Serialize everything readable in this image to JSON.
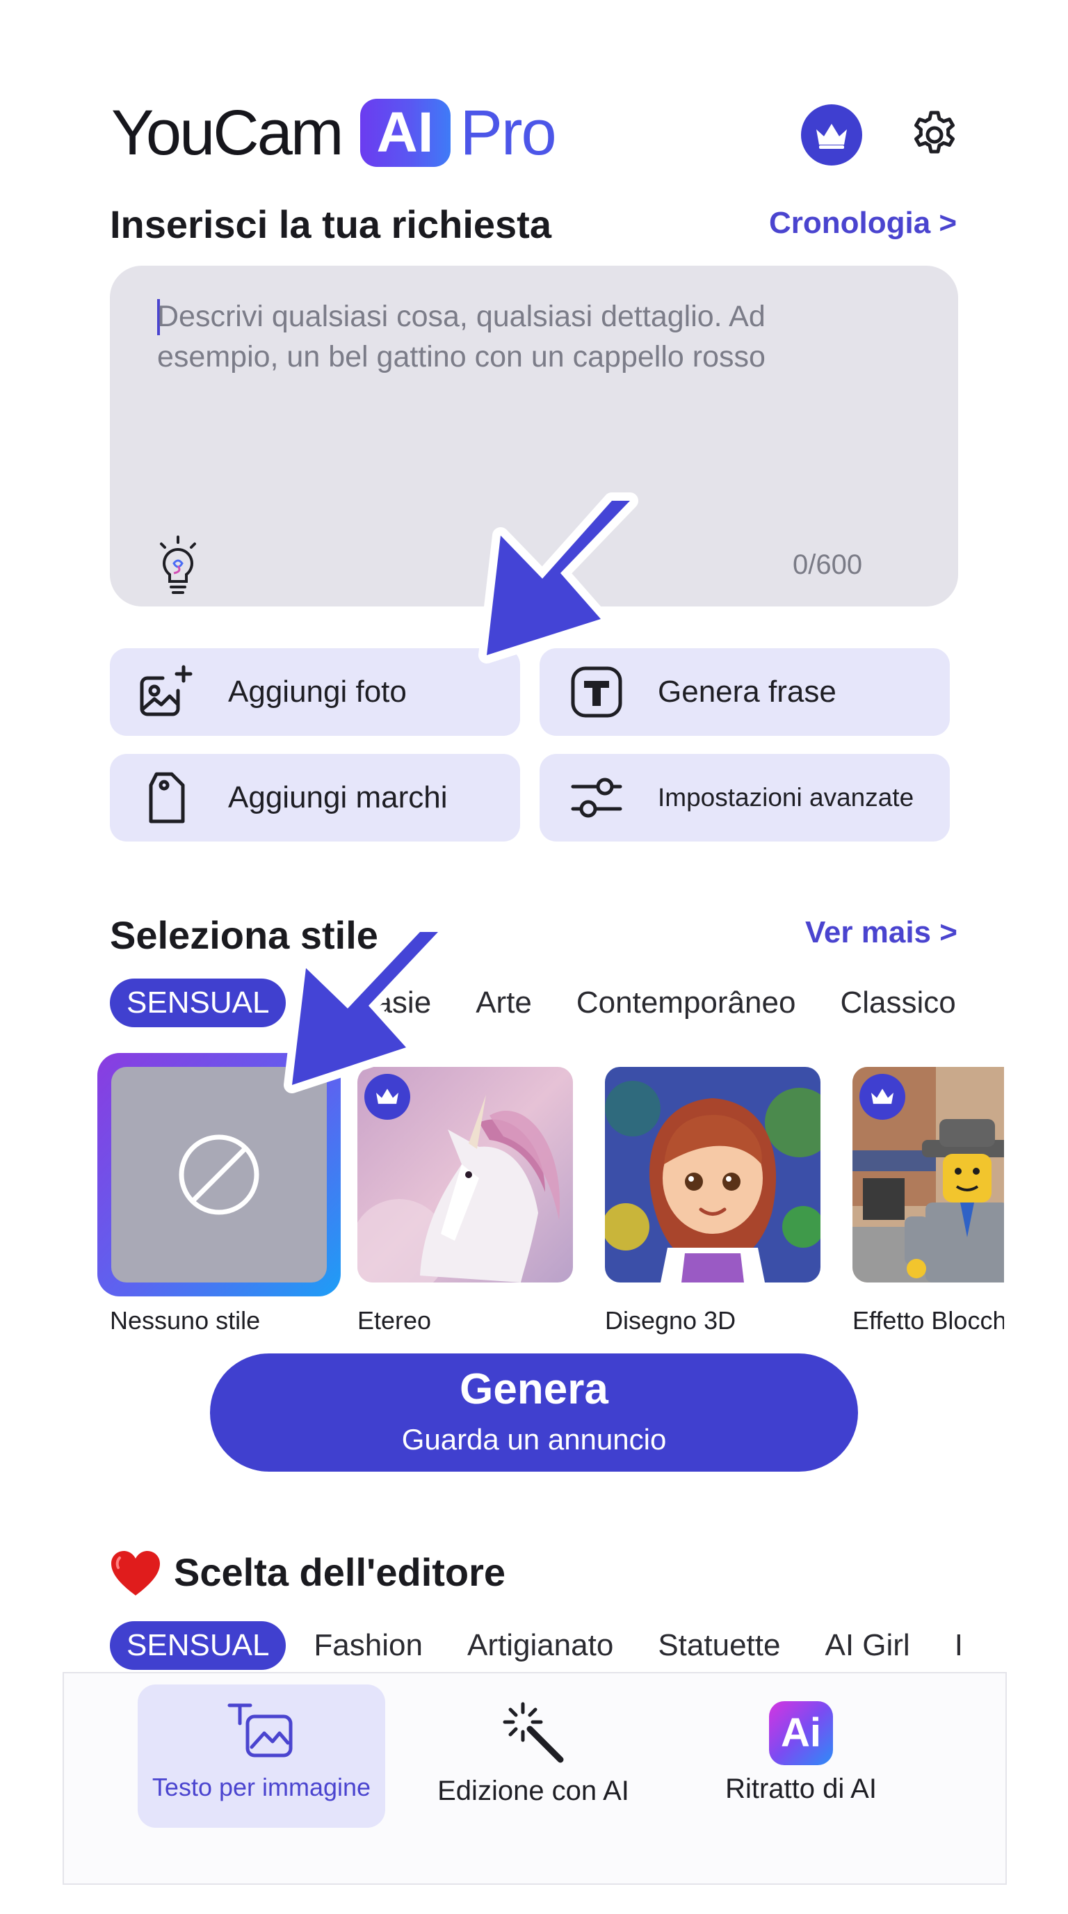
{
  "header": {
    "logo_text_main": "YouCam",
    "logo_text_badge": "AI",
    "logo_text_suffix": "Pro",
    "crown_icon": "crown-icon",
    "settings_icon": "gear-icon"
  },
  "prompt": {
    "title": "Inserisci la tua richiesta",
    "history_link": "Cronologia >",
    "placeholder": "Descrivi qualsiasi cosa, qualsiasi dettaglio. Ad esempio, un bel gattino con un cappello rosso",
    "counter": "0/600",
    "idea_icon": "lightbulb-icon"
  },
  "actions": [
    {
      "label": "Aggiungi foto",
      "icon": "add-photo-icon"
    },
    {
      "label": "Genera frase",
      "icon": "text-t-icon"
    },
    {
      "label": "Aggiungi marchi",
      "icon": "tag-icon"
    },
    {
      "label": "Impostazioni avanzate",
      "icon": "sliders-icon"
    }
  ],
  "styles": {
    "title": "Seleziona stile",
    "more_link": "Ver mais >",
    "chips": [
      "SENSUAL",
      "Fantasie",
      "Arte",
      "Contemporâneo",
      "Classico"
    ],
    "active_chip": "SENSUAL",
    "items": [
      {
        "label": "Nessuno stile",
        "selected": true,
        "premium": false
      },
      {
        "label": "Etereo",
        "selected": false,
        "premium": true
      },
      {
        "label": "Disegno 3D",
        "selected": false,
        "premium": false
      },
      {
        "label": "Effetto Blocchi",
        "selected": false,
        "premium": true
      }
    ]
  },
  "generate": {
    "label": "Genera",
    "sublabel": "Guarda un annuncio"
  },
  "editors_choice": {
    "title": "Scelta dell'editore",
    "chips": [
      "SENSUAL",
      "Fashion",
      "Artigianato",
      "Statuette",
      "AI Girl",
      "I"
    ],
    "active_chip": "SENSUAL"
  },
  "tabbar": {
    "items": [
      {
        "label": "Testo per immagine",
        "icon": "text-to-image-icon",
        "active": true
      },
      {
        "label": "Edizione con AI",
        "icon": "magic-wand-icon",
        "active": false
      },
      {
        "label": "Ritratto di AI",
        "icon": "ai-portrait-icon",
        "active": false
      }
    ]
  },
  "colors": {
    "accent": "#4040cf",
    "chip_bg": "#e6e6fa",
    "prompt_bg": "#e4e3ea"
  }
}
